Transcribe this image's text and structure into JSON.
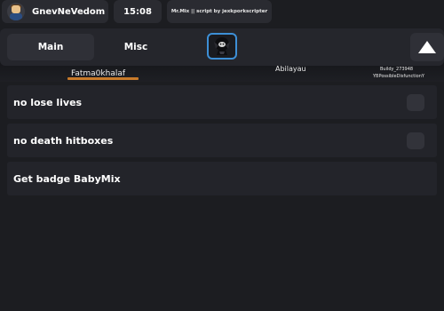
{
  "user": {
    "name": "GnevNeVedom"
  },
  "clock": {
    "time": "15:08"
  },
  "credit": {
    "text": "Mr.Mix || script by jexkporkscripter"
  },
  "tabs": [
    {
      "label": "Main"
    },
    {
      "label": "Misc"
    }
  ],
  "background_players": [
    {
      "text": "Fatma0khalaf"
    },
    {
      "text": "Abilayau"
    },
    {
      "text": "Buildy_273948"
    },
    {
      "text": "YBPossibleDisfunctionY"
    }
  ],
  "rows": [
    {
      "label": "no lose lives",
      "type": "toggle",
      "checked": false
    },
    {
      "label": "no death hitboxes",
      "type": "toggle",
      "checked": false
    },
    {
      "label": "Get badge BabyMix",
      "type": "button"
    }
  ],
  "icons": {
    "logo": "masked-figure-logo-icon",
    "collapse": "triangle-up-icon",
    "avatar": "avatar"
  },
  "colors": {
    "background": "#1c1d21",
    "panel": "#23242a",
    "accent": "#3d8fd6"
  }
}
